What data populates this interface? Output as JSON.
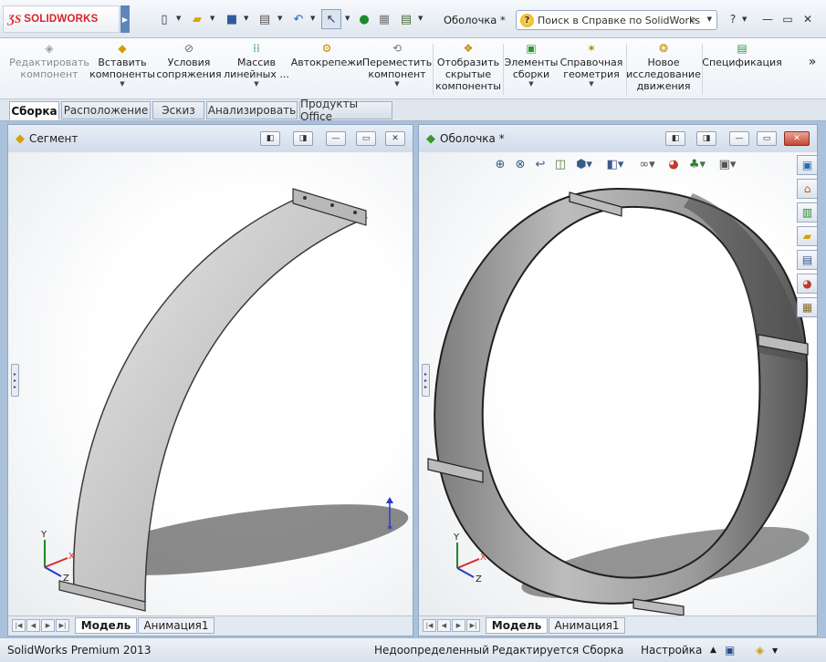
{
  "app": {
    "logo_mark": "ƷS",
    "logo_text": "SOLIDWORKS",
    "doc_title": "Оболочка *"
  },
  "help_search": {
    "placeholder": "Поиск в Справке по SolidWorks"
  },
  "quick_access": {
    "icons": [
      "new-document-icon",
      "open-icon",
      "save-icon",
      "print-icon",
      "undo-icon",
      "select-icon",
      "rebuild-icon",
      "file-properties-icon",
      "options-icon"
    ]
  },
  "window_controls": {
    "help": "?",
    "minimize": "—",
    "restore": "▭",
    "close": "✕"
  },
  "ribbon": {
    "buttons": [
      {
        "label": "Редактировать компонент",
        "disabled": true
      },
      {
        "label": "Вставить компоненты",
        "dropdown": true
      },
      {
        "label": "Условия сопряжения"
      },
      {
        "label": "Массив линейных ...",
        "dropdown": true
      },
      {
        "label": "Автокрепежи"
      },
      {
        "label": "Переместить компонент",
        "dropdown": true
      },
      {
        "label": "Отобразить скрытые компоненты"
      },
      {
        "label": "Элементы сборки",
        "dropdown": true
      },
      {
        "label": "Справочная геометрия",
        "dropdown": true
      },
      {
        "label": "Новое исследование движения"
      },
      {
        "label": "Спецификация"
      }
    ],
    "overflow": "»"
  },
  "command_tabs": [
    "Сборка",
    "Расположение",
    "Эскиз",
    "Анализировать",
    "Продукты Office"
  ],
  "docs": [
    {
      "title": "Сегмент",
      "model_tab": "Модель",
      "anim_tab": "Анимация1"
    },
    {
      "title": "Оболочка *",
      "model_tab": "Модель",
      "anim_tab": "Анимация1"
    }
  ],
  "triad": {
    "x": "X",
    "y": "Y",
    "z": "Z"
  },
  "status": {
    "product": "SolidWorks Premium 2013",
    "definition": "Недоопределенный",
    "editing": "Редактируется Сборка",
    "settings": "Настройка"
  },
  "colors": {
    "accent": "#d8232a",
    "frame": "#a9c1da",
    "close_red": "#c6472f"
  }
}
